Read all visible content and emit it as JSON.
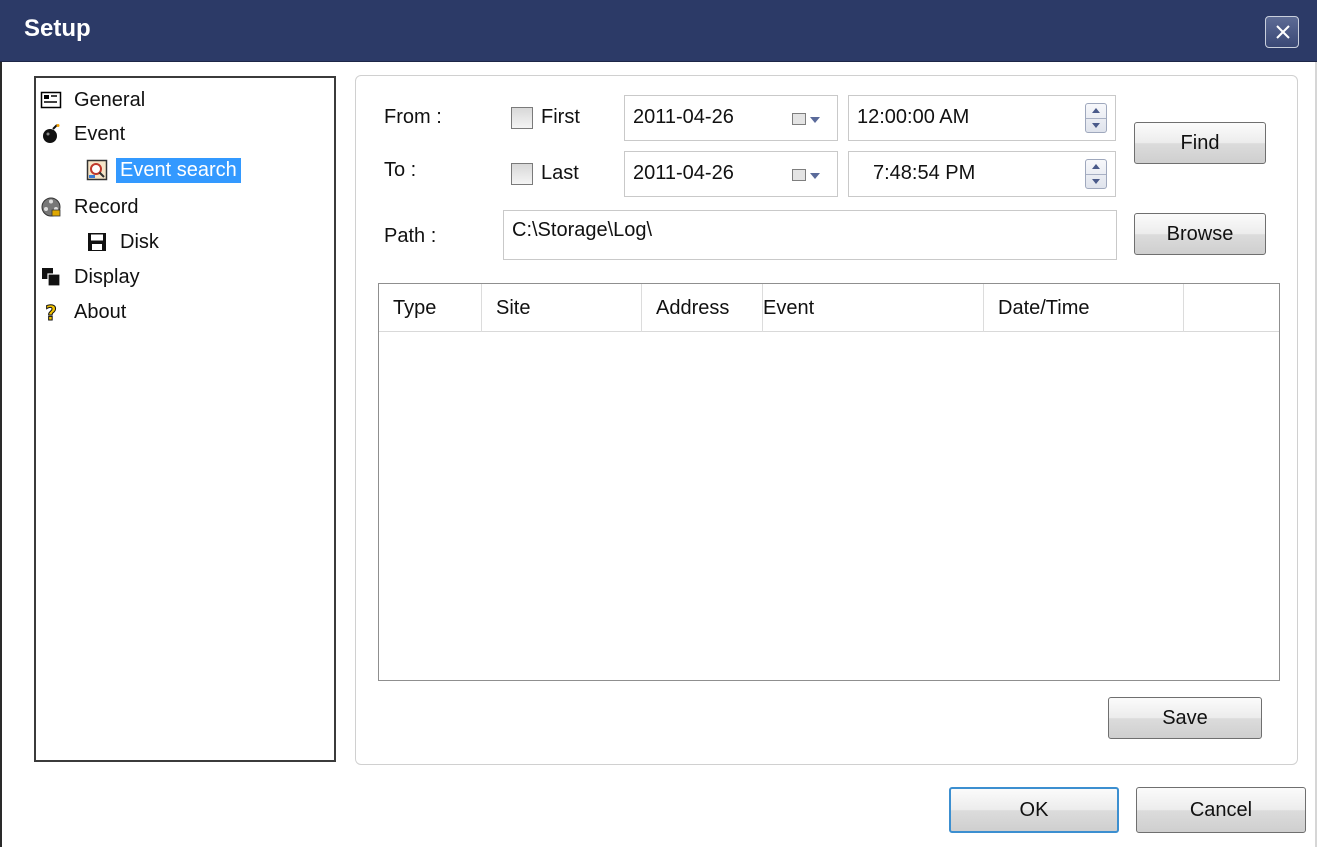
{
  "window": {
    "title": "Setup"
  },
  "tree": {
    "items": [
      {
        "label": "General",
        "icon": "general-icon"
      },
      {
        "label": "Event",
        "icon": "event-icon"
      },
      {
        "label": "Event search",
        "icon": "event-search-icon",
        "selected": true
      },
      {
        "label": "Record",
        "icon": "record-icon"
      },
      {
        "label": "Disk",
        "icon": "disk-icon"
      },
      {
        "label": "Display",
        "icon": "display-icon"
      },
      {
        "label": "About",
        "icon": "about-icon"
      }
    ]
  },
  "search": {
    "from_label": "From :",
    "to_label": "To :",
    "first_label": "First",
    "last_label": "Last",
    "first_checked": false,
    "last_checked": false,
    "from_date": "2011-04-26",
    "to_date": "2011-04-26",
    "from_time": "12:00:00 AM",
    "to_time": "7:48:54 PM",
    "path_label": "Path :",
    "path_value": "C:\\Storage\\Log\\",
    "find_button": "Find",
    "browse_button": "Browse"
  },
  "results": {
    "columns": [
      "Type",
      "Site",
      "Address",
      "Event",
      "Date/Time"
    ],
    "rows": []
  },
  "buttons": {
    "save": "Save",
    "ok": "OK",
    "cancel": "Cancel"
  }
}
